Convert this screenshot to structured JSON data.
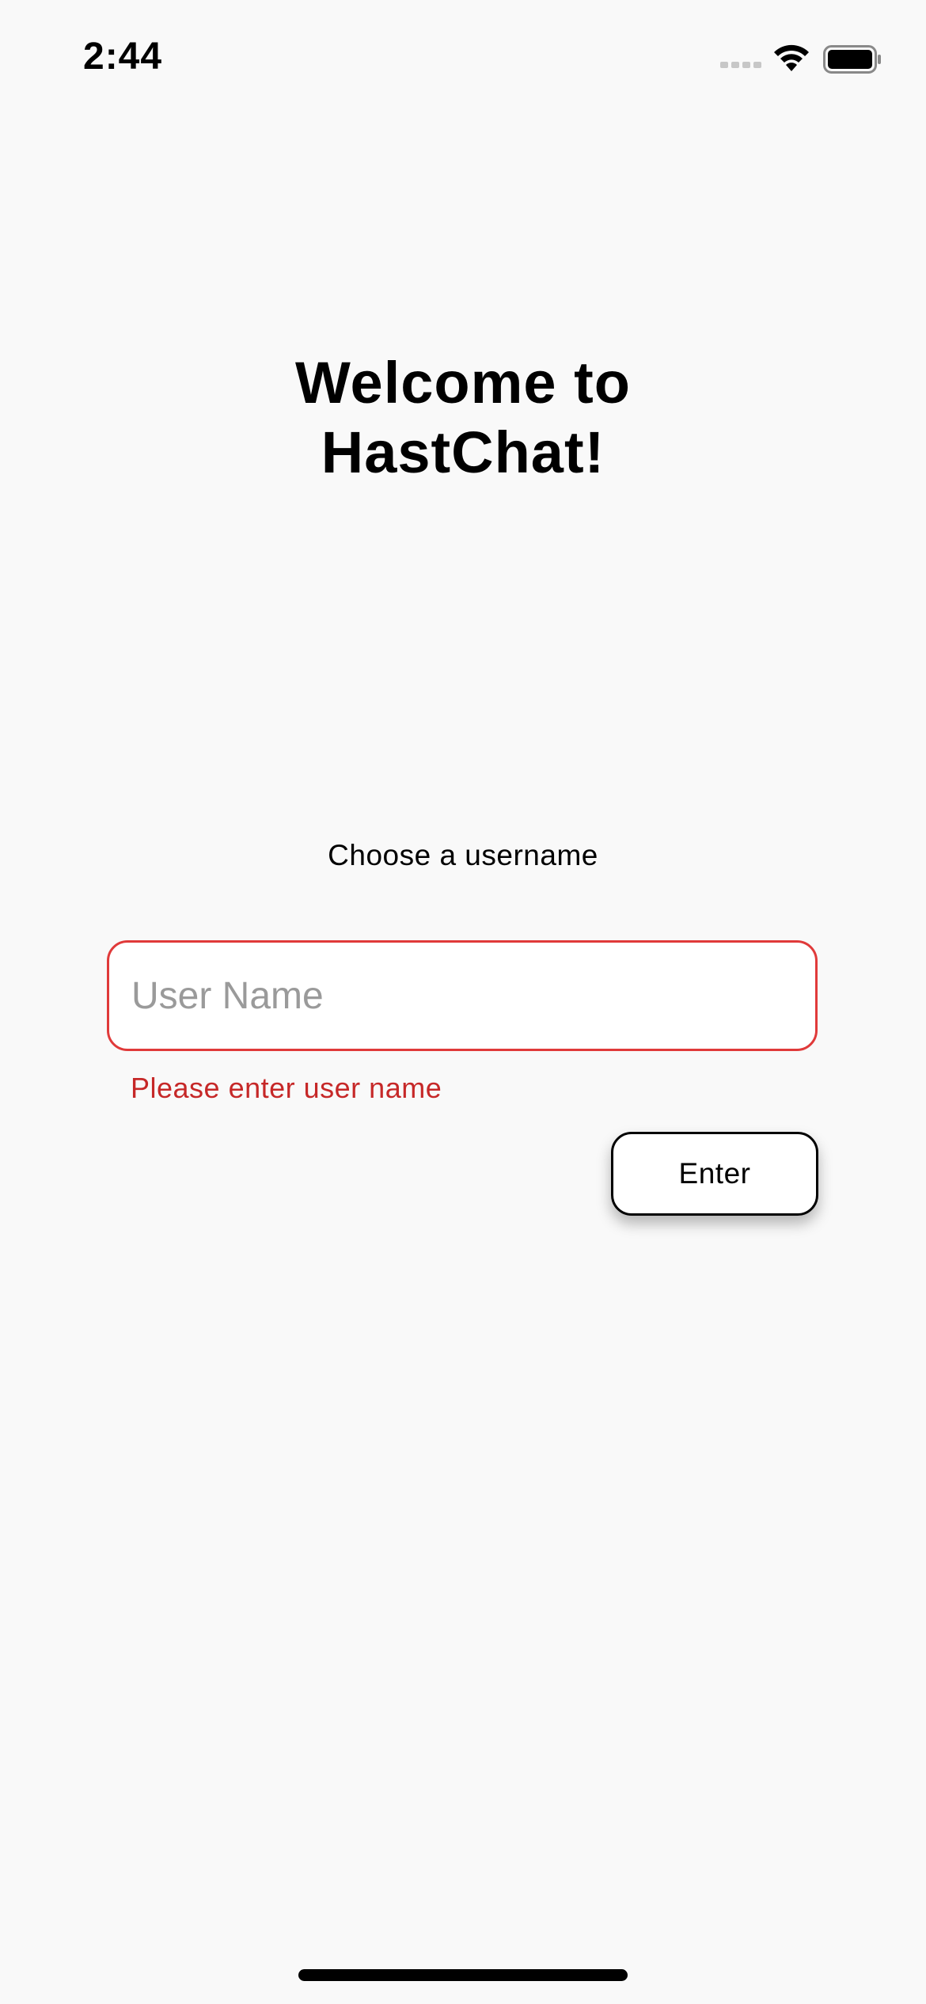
{
  "status_bar": {
    "time": "2:44",
    "icons": [
      "signal-icon",
      "wifi-icon",
      "battery-icon"
    ]
  },
  "main": {
    "title_line1": "Welcome to",
    "title_line2": "HastChat!",
    "prompt": "Choose a username",
    "username_input": {
      "value": "",
      "placeholder": "User Name"
    },
    "error_message": "Please enter user name",
    "enter_label": "Enter"
  },
  "colors": {
    "background": "#f9f9f9",
    "error": "#c62828",
    "input_border_error": "#e03a3a",
    "text": "#000000"
  }
}
